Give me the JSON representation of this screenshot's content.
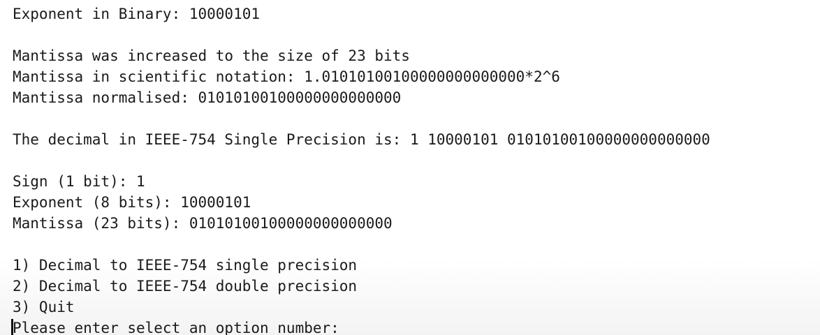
{
  "terminal": {
    "lines": [
      "Exponent in Binary: 10000101",
      "",
      "Mantissa was increased to the size of 23 bits",
      "Mantissa in scientific notation: 1.01010100100000000000000*2^6",
      "Mantissa normalised: 01010100100000000000000",
      "",
      "The decimal in IEEE-754 Single Precision is: 1 10000101 01010100100000000000000",
      "",
      "Sign (1 bit): 1",
      "Exponent (8 bits): 10000101",
      "Mantissa (23 bits): 01010100100000000000000",
      "",
      "1) Decimal to IEEE-754 single precision",
      "2) Decimal to IEEE-754 double precision",
      "3) Quit"
    ],
    "prompt": "Please enter select an option number: "
  }
}
